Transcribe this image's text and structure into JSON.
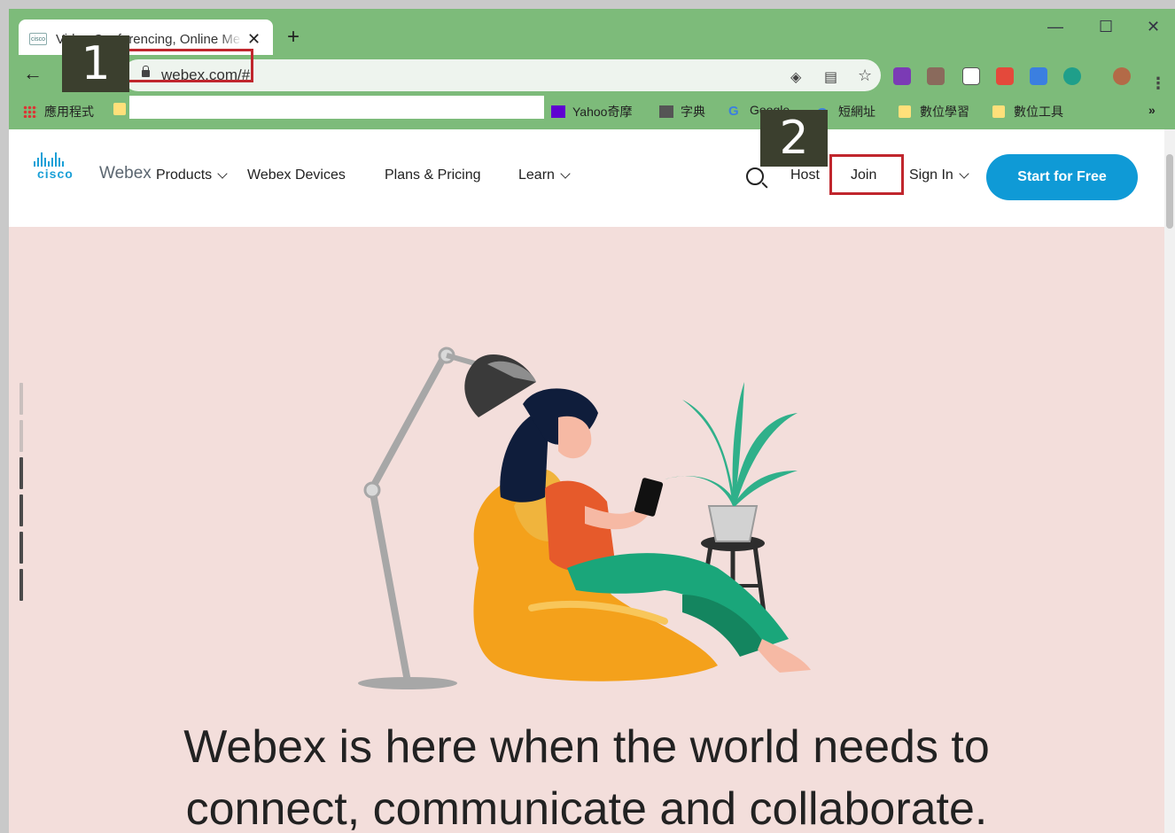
{
  "browser": {
    "tab_title": "Video Conferencing, Online Me",
    "new_tab_symbol": "+",
    "close_symbol": "✕",
    "url": "webex.com/#",
    "bookmarks": [
      {
        "label": "應用程式"
      },
      {
        "label": "Yahoo奇摩"
      },
      {
        "label": "字典"
      },
      {
        "label": "Google"
      },
      {
        "label": "短網址"
      },
      {
        "label": "數位學習"
      },
      {
        "label": "數位工具"
      }
    ],
    "more_bookmarks": "»",
    "window_controls": {
      "minimize": "—",
      "maximize": "☐",
      "close": "✕"
    }
  },
  "site": {
    "logo": {
      "cisco": "cisco",
      "product": "Webex"
    },
    "nav": {
      "products": "Products",
      "devices": "Webex Devices",
      "pricing": "Plans & Pricing",
      "learn": "Learn"
    },
    "host": "Host",
    "join": "Join",
    "sign_in": "Sign In",
    "cta": "Start for Free",
    "headline_line1": "Webex is here when the world needs to",
    "headline_line2": "connect, communicate and collaborate."
  },
  "annotations": {
    "step1": "1",
    "step2": "2",
    "highlight_color": "#c0262d",
    "badge_color": "#3b3f2e"
  },
  "colors": {
    "chrome": "#7dbb7a",
    "hero_bg": "#f3dedb",
    "cta_bg": "#0f9ad6",
    "brand": "#1ba0d7"
  }
}
